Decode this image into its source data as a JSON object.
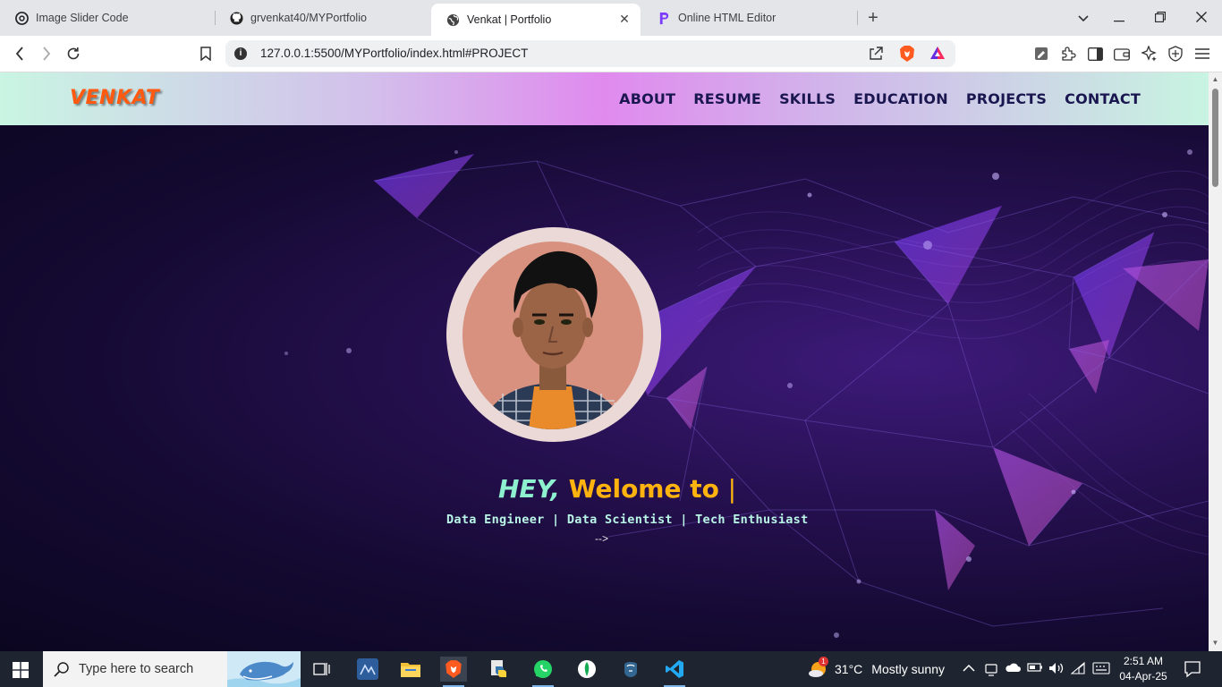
{
  "browser": {
    "tabs": [
      {
        "title": "Image Slider Code",
        "icon": "openai-icon"
      },
      {
        "title": "grvenkat40/MYPortfolio",
        "icon": "github-icon"
      },
      {
        "title": "Venkat | Portfolio",
        "icon": "globe-icon",
        "active": true
      },
      {
        "title": "Online HTML Editor",
        "icon": "editor-icon"
      }
    ],
    "url": "127.0.0.1:5500/MYPortfolio/index.html#PROJECT"
  },
  "site": {
    "logo": "VENKAT",
    "nav": [
      "ABOUT",
      "RESUME",
      "SKILLS",
      "EDUCATION",
      "PROJECTS",
      "CONTACT"
    ],
    "hero": {
      "greeting": "HEY,",
      "welcome": "Welome to",
      "caret": "|",
      "subtitle": "Data Engineer | Data Scientist | Tech Enthusiast",
      "arrow": "-->"
    }
  },
  "taskbar": {
    "search_placeholder": "Type here to search",
    "weather_temp": "31°C",
    "weather_text": "Mostly sunny",
    "weather_badge": "1",
    "time": "2:51 AM",
    "date": "04-Apr-25"
  },
  "colors": {
    "logo": "#ff5a10",
    "nav_text": "#1a1650",
    "hey": "#8df0cf",
    "welcome": "#ffb30f",
    "subtitle": "#b9f5e6"
  }
}
